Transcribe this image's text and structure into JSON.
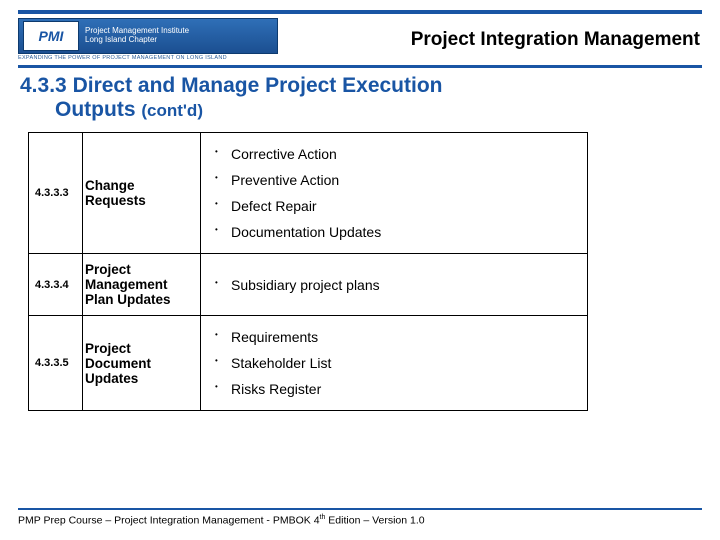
{
  "header": {
    "org_top": "Project Management Institute",
    "org_bottom": "Long Island Chapter",
    "tagline": "EXPANDING THE POWER OF PROJECT MANAGEMENT ON LONG ISLAND",
    "badge": "PMI",
    "title": "Project Integration Management"
  },
  "section": {
    "number": "4.3.3",
    "title_line1": "Direct and Manage Project Execution",
    "title_line2": "Outputs",
    "cont": "(cont'd)"
  },
  "rows": [
    {
      "num": "4.3.3.3",
      "name": "Change Requests",
      "items": [
        "Corrective Action",
        "Preventive Action",
        "Defect Repair",
        "Documentation Updates"
      ]
    },
    {
      "num": "4.3.3.4",
      "name": "Project Management Plan Updates",
      "items": [
        "Subsidiary project plans"
      ]
    },
    {
      "num": "4.3.3.5",
      "name": "Project Document Updates",
      "items": [
        "Requirements",
        "Stakeholder List",
        "Risks Register"
      ]
    }
  ],
  "footer": {
    "text_a": "PMP Prep Course – Project Integration Management - PMBOK 4",
    "text_sup": "th",
    "text_b": " Edition – Version 1.0"
  }
}
